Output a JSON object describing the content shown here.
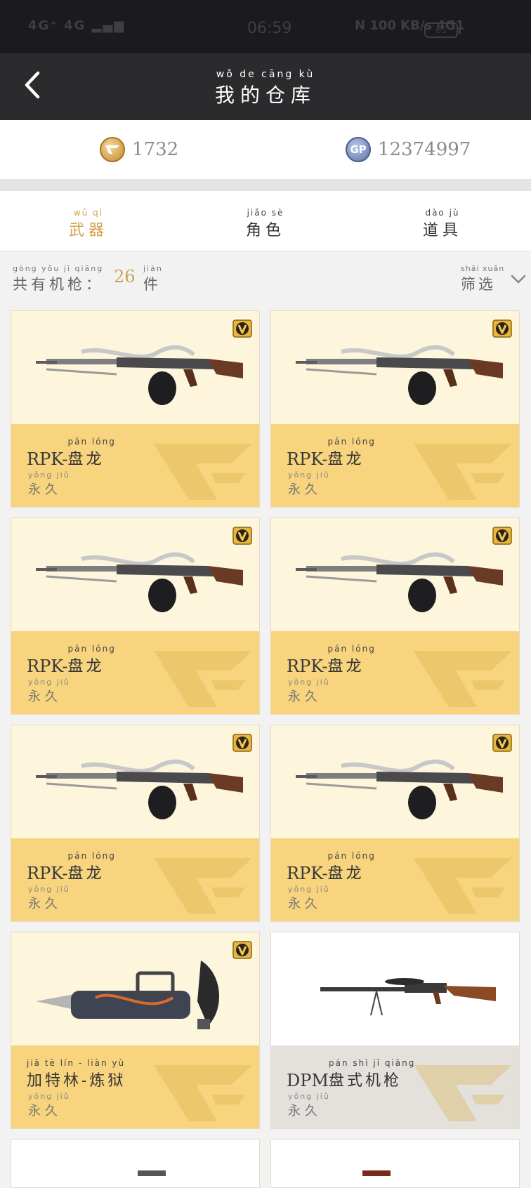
{
  "status_bar": {
    "left": "4G⁺ 4G ▂▄▆",
    "time": "06:59",
    "right": "N  100 KB/s  4G1",
    "battery": "65"
  },
  "nav": {
    "title_pinyin": "wǒ de cāng kù",
    "title": "我的仓库"
  },
  "currency": {
    "cf_icon": "cf-coin-icon",
    "cf_amount": "1732",
    "gp_icon_text": "GP",
    "gp_amount": "12374997"
  },
  "tabs": [
    {
      "pinyin": "wǔ qì",
      "label": "武器"
    },
    {
      "pinyin": "jiǎo sè",
      "label": "角色"
    },
    {
      "pinyin": "dào jù",
      "label": "道具"
    }
  ],
  "list_header": {
    "label_pinyin": "gòng yǒu jī qiāng",
    "label": "共有机枪：",
    "count": "26",
    "unit_pinyin": "jiàn",
    "unit": "件",
    "filter_pinyin": "shāi xuǎn",
    "filter": "筛选"
  },
  "items": [
    {
      "prefix": "RPK-",
      "name_pinyin": "pán lóng",
      "name": "盘龙",
      "dur_pinyin": "yǒng jiǔ",
      "duration": "永久"
    },
    {
      "prefix": "RPK-",
      "name_pinyin": "pán lóng",
      "name": "盘龙",
      "dur_pinyin": "yǒng jiǔ",
      "duration": "永久"
    },
    {
      "prefix": "RPK-",
      "name_pinyin": "pán lóng",
      "name": "盘龙",
      "dur_pinyin": "yǒng jiǔ",
      "duration": "永久"
    },
    {
      "prefix": "RPK-",
      "name_pinyin": "pán lóng",
      "name": "盘龙",
      "dur_pinyin": "yǒng jiǔ",
      "duration": "永久"
    },
    {
      "prefix": "RPK-",
      "name_pinyin": "pán lóng",
      "name": "盘龙",
      "dur_pinyin": "yǒng jiǔ",
      "duration": "永久"
    },
    {
      "prefix": "RPK-",
      "name_pinyin": "pán lóng",
      "name": "盘龙",
      "dur_pinyin": "yǒng jiǔ",
      "duration": "永久"
    },
    {
      "prefix": "",
      "name_pinyin": "jiā tè lín - liàn yù",
      "name": "加特林-炼狱",
      "dur_pinyin": "yǒng jiǔ",
      "duration": "永久"
    },
    {
      "prefix": "DPM",
      "name_pinyin": "pán shì jī qiāng",
      "name": "盘式机枪",
      "dur_pinyin": "yǒng jiǔ",
      "duration": "永久"
    }
  ],
  "colors": {
    "accent": "#d4a24c",
    "card_gold": "#f7d47d",
    "card_cream": "#fdf6dc",
    "card_grey": "#e4e1dc"
  }
}
